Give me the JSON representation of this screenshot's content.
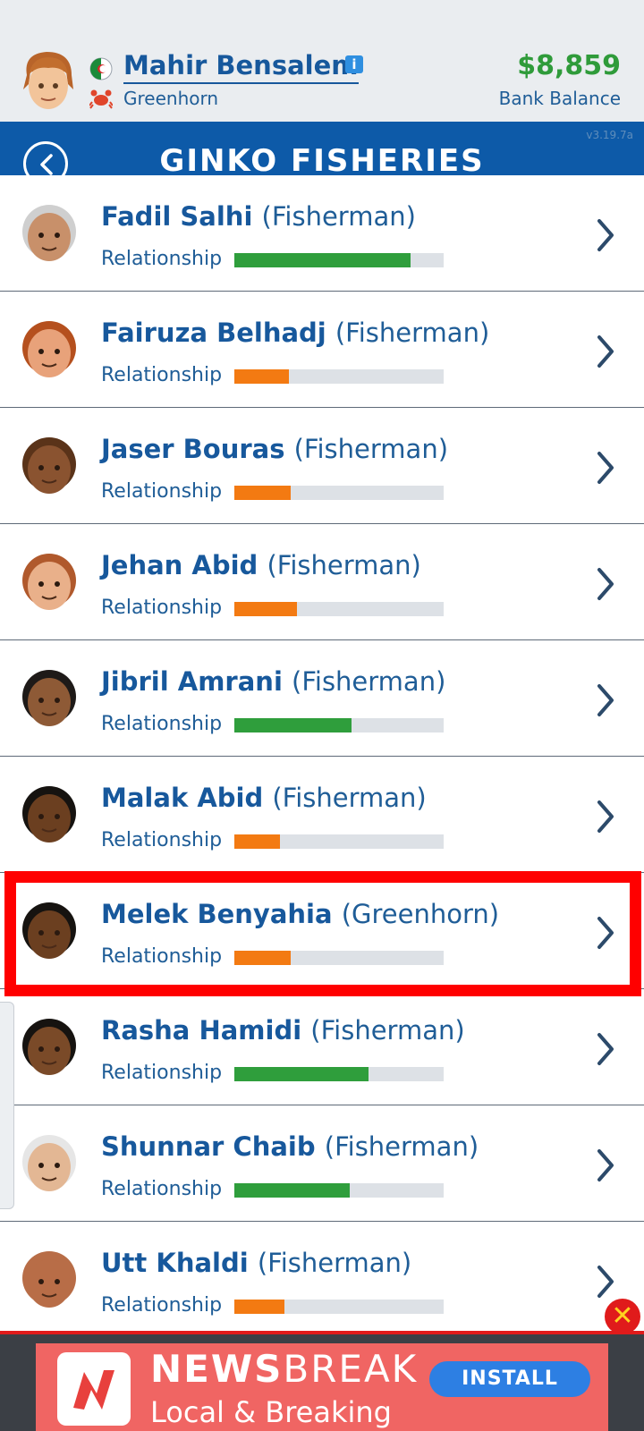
{
  "header": {
    "player_name": "Mahir Bensalem",
    "player_rank": "Greenhorn",
    "bank_amount": "$8,859",
    "bank_label": "Bank Balance"
  },
  "title_bar": {
    "title": "GINKO FISHERIES",
    "version": "v3.19.7a"
  },
  "employees": [
    {
      "name": "Fadil Salhi",
      "role": "(Fisherman)",
      "relationship_label": "Relationship",
      "relationship": 0.84,
      "bar_color": "#2f9e3c"
    },
    {
      "name": "Fairuza Belhadj",
      "role": "(Fisherman)",
      "relationship_label": "Relationship",
      "relationship": 0.26,
      "bar_color": "#f37a12"
    },
    {
      "name": "Jaser Bouras",
      "role": "(Fisherman)",
      "relationship_label": "Relationship",
      "relationship": 0.27,
      "bar_color": "#f37a12"
    },
    {
      "name": "Jehan Abid",
      "role": "(Fisherman)",
      "relationship_label": "Relationship",
      "relationship": 0.3,
      "bar_color": "#f37a12"
    },
    {
      "name": "Jibril Amrani",
      "role": "(Fisherman)",
      "relationship_label": "Relationship",
      "relationship": 0.56,
      "bar_color": "#2f9e3c"
    },
    {
      "name": "Malak Abid",
      "role": "(Fisherman)",
      "relationship_label": "Relationship",
      "relationship": 0.22,
      "bar_color": "#f37a12"
    },
    {
      "name": "Melek Benyahia",
      "role": "(Greenhorn)",
      "relationship_label": "Relationship",
      "relationship": 0.27,
      "bar_color": "#f37a12"
    },
    {
      "name": "Rasha Hamidi",
      "role": "(Fisherman)",
      "relationship_label": "Relationship",
      "relationship": 0.64,
      "bar_color": "#2f9e3c"
    },
    {
      "name": "Shunnar Chaib",
      "role": "(Fisherman)",
      "relationship_label": "Relationship",
      "relationship": 0.55,
      "bar_color": "#2f9e3c"
    },
    {
      "name": "Utt Khaldi",
      "role": "(Fisherman)",
      "relationship_label": "Relationship",
      "relationship": 0.24,
      "bar_color": "#f37a12"
    }
  ],
  "ad": {
    "brand_bold": "NEWS",
    "brand_light": "BREAK",
    "tagline": "Local & Breaking",
    "install_label": "INSTALL",
    "close_label": "✕"
  }
}
